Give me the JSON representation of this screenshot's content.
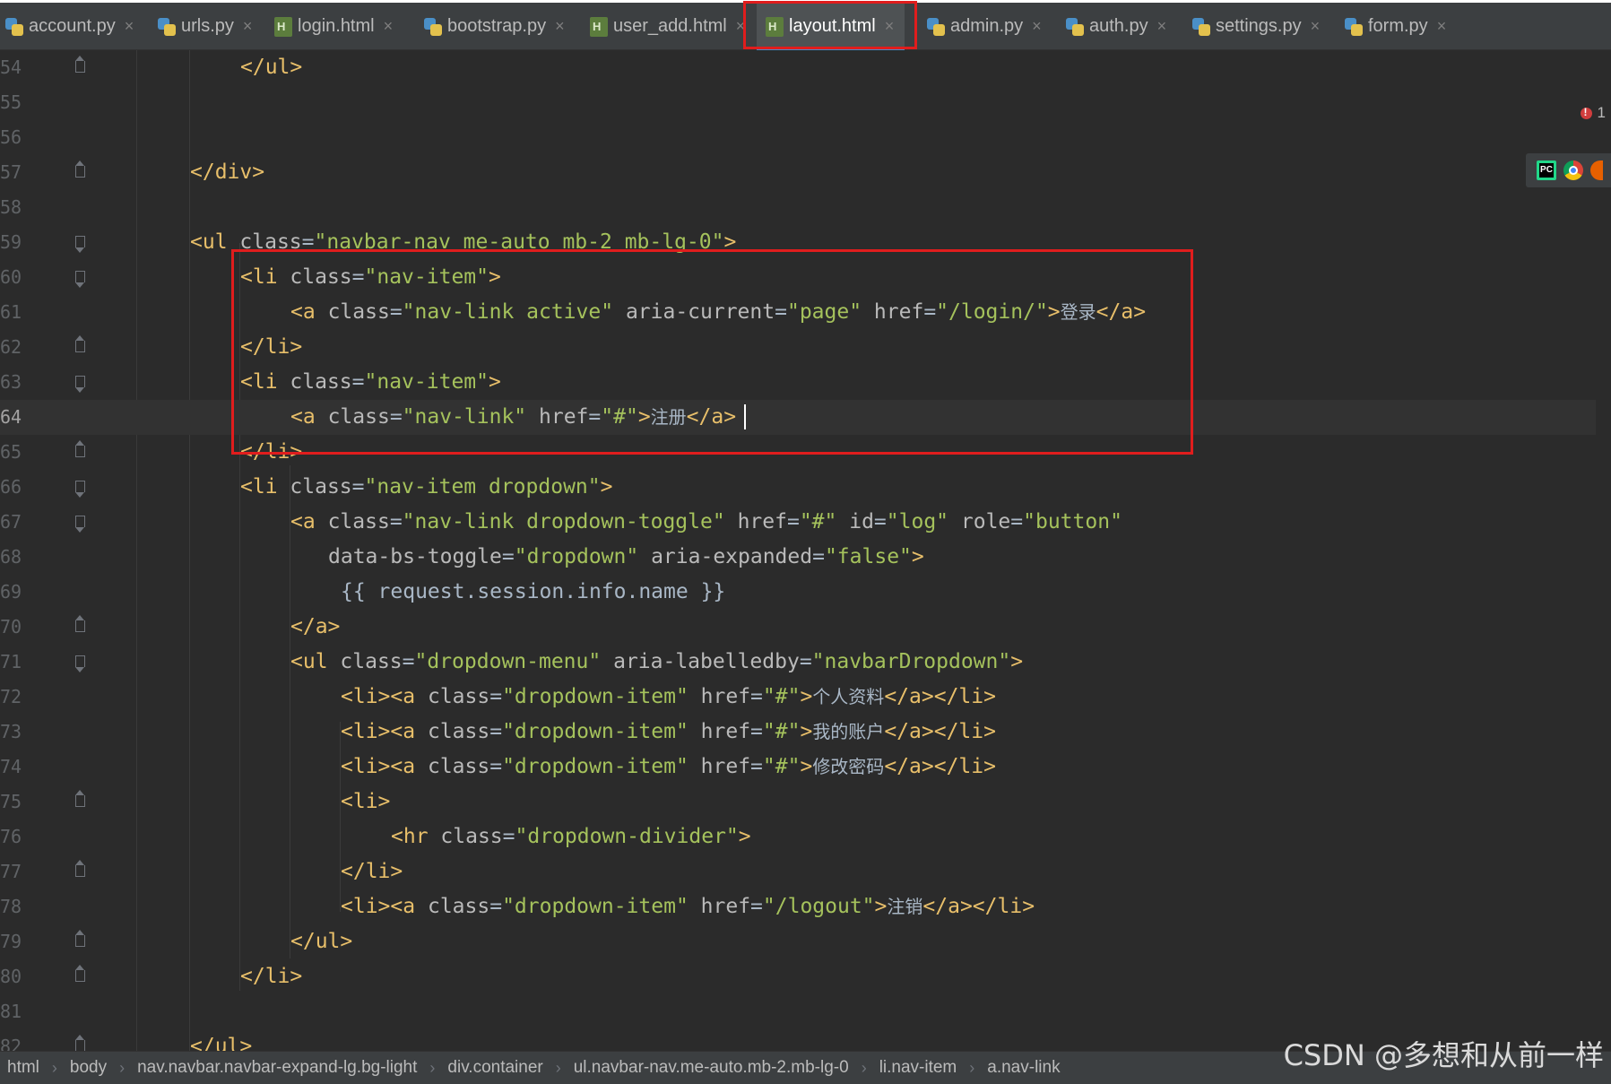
{
  "tabs": [
    {
      "label": "account.py",
      "icon": "python-file-icon",
      "active": false
    },
    {
      "label": "urls.py",
      "icon": "python-file-icon",
      "active": false
    },
    {
      "label": "login.html",
      "icon": "html-file-icon",
      "active": false
    },
    {
      "label": "bootstrap.py",
      "icon": "python-file-icon",
      "active": false
    },
    {
      "label": "user_add.html",
      "icon": "html-file-icon",
      "active": false
    },
    {
      "label": "layout.html",
      "icon": "html-file-icon",
      "active": true
    },
    {
      "label": "admin.py",
      "icon": "python-file-icon",
      "active": false
    },
    {
      "label": "auth.py",
      "icon": "python-file-icon",
      "active": false
    },
    {
      "label": "settings.py",
      "icon": "python-file-icon",
      "active": false
    },
    {
      "label": "form.py",
      "icon": "python-file-icon",
      "active": false
    }
  ],
  "tab_close_glyph": "×",
  "error_count": "1",
  "current_line": "64",
  "lines": [
    {
      "num": "54",
      "text": "</ul>"
    },
    {
      "num": "55",
      "text": ""
    },
    {
      "num": "56",
      "text": ""
    },
    {
      "num": "57",
      "text": "</div>"
    },
    {
      "num": "58",
      "text": ""
    },
    {
      "num": "59",
      "text": "<ul class=\"navbar-nav me-auto mb-2 mb-lg-0\">"
    },
    {
      "num": "60",
      "text": "<li class=\"nav-item\">"
    },
    {
      "num": "61",
      "text": "<a class=\"nav-link active\" aria-current=\"page\" href=\"/login/\">登录</a>"
    },
    {
      "num": "62",
      "text": "</li>"
    },
    {
      "num": "63",
      "text": "<li class=\"nav-item\">"
    },
    {
      "num": "64",
      "text": "<a class=\"nav-link\" href=\"#\">注册</a>"
    },
    {
      "num": "65",
      "text": "</li>"
    },
    {
      "num": "66",
      "text": "<li class=\"nav-item dropdown\">"
    },
    {
      "num": "67",
      "text": "<a class=\"nav-link dropdown-toggle\" href=\"#\" id=\"log\" role=\"button\""
    },
    {
      "num": "68",
      "text": "data-bs-toggle=\"dropdown\" aria-expanded=\"false\">"
    },
    {
      "num": "69",
      "text": "{{ request.session.info.name }}"
    },
    {
      "num": "70",
      "text": "</a>"
    },
    {
      "num": "71",
      "text": "<ul class=\"dropdown-menu\" aria-labelledby=\"navbarDropdown\">"
    },
    {
      "num": "72",
      "text": "<li><a class=\"dropdown-item\" href=\"#\">个人资料</a></li>"
    },
    {
      "num": "73",
      "text": "<li><a class=\"dropdown-item\" href=\"#\">我的账户</a></li>"
    },
    {
      "num": "74",
      "text": "<li><a class=\"dropdown-item\" href=\"#\">修改密码</a></li>"
    },
    {
      "num": "75",
      "text": "<li>"
    },
    {
      "num": "76",
      "text": "<hr class=\"dropdown-divider\">"
    },
    {
      "num": "77",
      "text": "</li>"
    },
    {
      "num": "78",
      "text": "<li><a class=\"dropdown-item\" href=\"/logout\">注销</a></li>"
    },
    {
      "num": "79",
      "text": "</ul>"
    },
    {
      "num": "80",
      "text": "</li>"
    },
    {
      "num": "81",
      "text": ""
    },
    {
      "num": "82",
      "text": "</ul>"
    }
  ],
  "breadcrumb": [
    "html",
    "body",
    "nav.navbar.navbar-expand-lg.bg-light",
    "div.container",
    "ul.navbar-nav.me-auto.mb-2.mb-lg-0",
    "li.nav-item",
    "a.nav-link"
  ],
  "breadcrumb_separator": "›",
  "watermark": "CSDN @多想和从前一样",
  "colors": {
    "background": "#2b2b2b",
    "tag": "#e8bf6a",
    "attribute": "#bababa",
    "string": "#a5c25c",
    "text": "#a9b7c6",
    "highlight_box": "#e01d1d"
  }
}
